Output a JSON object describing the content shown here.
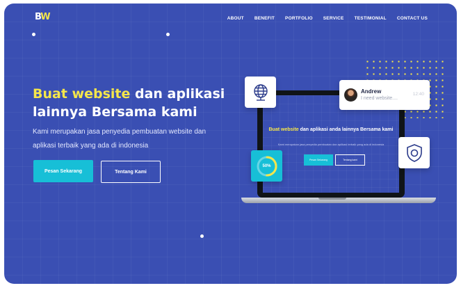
{
  "brand": {
    "logo_b": "B",
    "logo_w": "W"
  },
  "nav": [
    {
      "label": "ABOUT"
    },
    {
      "label": "BENEFIT"
    },
    {
      "label": "PORTFOLIO"
    },
    {
      "label": "SERVICE"
    },
    {
      "label": "TESTIMONIAL"
    },
    {
      "label": "CONTACT US"
    }
  ],
  "hero": {
    "title_highlight": "Buat website",
    "title_rest": " dan aplikasi lainnya Bersama kami",
    "description": "Kami merupakan jasa penyedia pembuatan website dan aplikasi terbaik yang ada di indonesia",
    "primary_button": "Pesan Sekarang",
    "secondary_button": "Tentang Kami"
  },
  "mockup": {
    "title_highlight": "Buat website",
    "title_rest": " dan aplikasi anda lainnya Bersama kami",
    "description": "Kami merupakan jasa penyedia pembuatan dan aplikasi terbaik yang ada di indonesia",
    "primary_button": "Pesan Sekarang",
    "secondary_button": "Tentang kami"
  },
  "chat": {
    "name": "Andrew",
    "message": "I need website....",
    "time": "12:40"
  },
  "progress": {
    "label": "50%",
    "value": 0.5
  },
  "colors": {
    "background": "#3a4fb3",
    "accent_yellow": "#f5e64a",
    "accent_cyan": "#17bfd7"
  },
  "icons": {
    "globe": "globe-icon",
    "shield": "shield-icon"
  }
}
